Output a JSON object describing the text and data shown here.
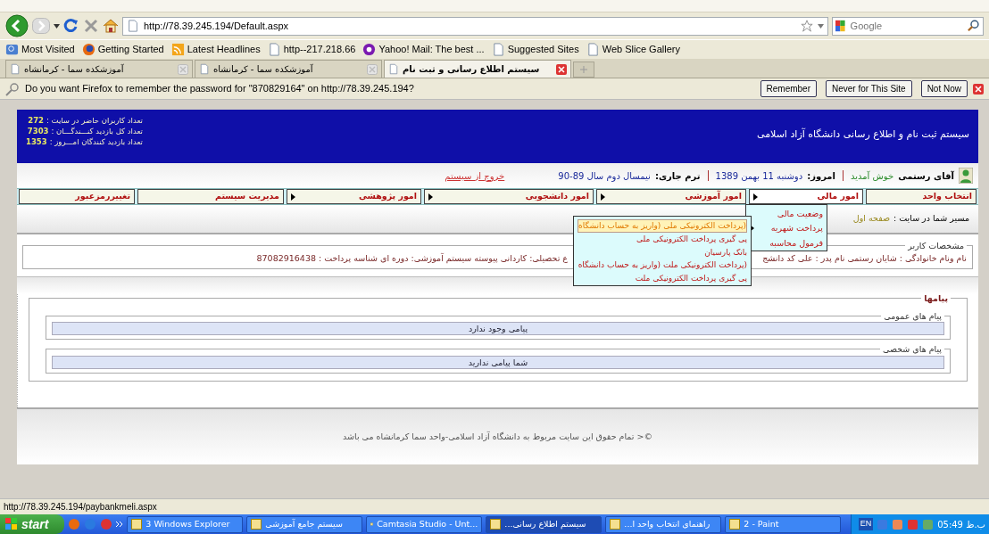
{
  "toolbar": {
    "url": "http://78.39.245.194/Default.aspx",
    "search_placeholder": "Google"
  },
  "bookmarks": [
    "Web Slice Gallery",
    "Suggested Sites",
    "Yahoo! Mail: The best ...",
    "http--217.218.66",
    "Latest Headlines",
    "Getting Started",
    "Most Visited"
  ],
  "tabs": [
    {
      "label": "سیستم اطلاع رسانی و ثبت نام",
      "selected": true
    },
    {
      "label": "آموزشکده سما - کرمانشاه",
      "selected": false
    },
    {
      "label": "آموزشکده سما - کرمانشاه",
      "selected": false
    }
  ],
  "password_bar": {
    "message": "Do you want Firefox to remember the password for \"870829164\" on http://78.39.245.194?",
    "buttons": [
      "Not Now",
      "Never for This Site",
      "Remember"
    ]
  },
  "header": {
    "title": "سیستم ثبت نام و اطلاع رسانی دانشگاه آزاد اسلامی",
    "stats": [
      {
        "label": "تعداد کاربران حاضر در سایت :",
        "value": "272"
      },
      {
        "label": "تعداد کل بازدید کنـــندگـــان :",
        "value": "7303"
      },
      {
        "label": "تعداد بازدید کنندگان امـــروز :",
        "value": "1353"
      }
    ]
  },
  "welcome": {
    "name": "آقای رستمی",
    "greeting": "خوش آمدید",
    "today_label": "امروز:",
    "today": "دوشنبه 11 بهمن 1389",
    "term_label": "ترم جاری:",
    "term": "نیمسال دوم سال 89-90",
    "logout": "خروج از سیستم"
  },
  "menu": [
    {
      "label": "انتخاب واحد",
      "has_submenu": false,
      "expanded": false
    },
    {
      "label": "امور مالی",
      "has_submenu": true,
      "expanded": true
    },
    {
      "label": "امور آموزشی",
      "has_submenu": true,
      "expanded": false
    },
    {
      "label": "امور دانشجویی",
      "has_submenu": true,
      "expanded": false
    },
    {
      "label": "امور پژوهشی",
      "has_submenu": true,
      "expanded": false
    },
    {
      "label": "مدیریت سیستم",
      "has_submenu": false,
      "expanded": false
    },
    {
      "label": "تغییررمزعبور",
      "has_submenu": false,
      "expanded": false
    }
  ],
  "submenu": [
    {
      "label": "وضعیت مالی",
      "has_submenu": false
    },
    {
      "label": "پرداخت شهریه",
      "has_submenu": true
    },
    {
      "label": "فرمول محاسبه",
      "has_submenu": false
    }
  ],
  "subsubmenu": {
    "open": true,
    "items": [
      {
        "label": "(پرداخت الکترونیکی ملی (واریز به حساب دانشگاه",
        "selected": true
      },
      {
        "label": "پی گیری پرداخت الکترونیکی ملی",
        "selected": false
      },
      {
        "label": "بانک پارسیان",
        "selected": false
      },
      {
        "label": "(پرداخت الکترونیکی ملت (واریز به حساب دانشگاه",
        "selected": false
      },
      {
        "label": "پی گیری پرداخت الکترونیکی ملت",
        "selected": false
      }
    ]
  },
  "breadcrumb": {
    "label": "مسیر شما در سایت :",
    "page": "صفحه اول"
  },
  "user_info": {
    "legend": "مشخصات کاربر",
    "text_right": "نام ونام خانوادگی : شایان رستمی نام پدر : علی کد دانشج",
    "text_left": "ع تحصیلی: کاردانی پیوسته سیستم آموزشی: دوره ای شناسه پرداخت : 87082916438"
  },
  "messages": {
    "legend": "پیامها",
    "groups": [
      {
        "legend": "پیام های عمومی",
        "text": "پیامی وجود ندارد"
      },
      {
        "legend": "پیام های شخصی",
        "text": "شما پیامی ندارید"
      }
    ]
  },
  "footer": "©< تمام حقوق این سایت مربوط به دانشگاه آزاد اسلامی-واحد سما کرمانشاه می باشد",
  "status_bar": "http://78.39.245.194/paybankmeli.aspx",
  "taskbar": {
    "start": "start",
    "items": [
      {
        "label": "2 - Paint",
        "selected": false
      },
      {
        "label": "راهنمای انتخاب واحد ا...",
        "selected": false
      },
      {
        "label": "سیستم اطلاع رسانی...",
        "selected": true
      },
      {
        "label": "Camtasia Studio - Unt...",
        "selected": false
      },
      {
        "label": "سیستم جامع آموزشی",
        "selected": false
      },
      {
        "label": "3 Windows Explorer",
        "selected": false
      }
    ],
    "language": "EN",
    "clock": "05:49 ب.ظ"
  }
}
